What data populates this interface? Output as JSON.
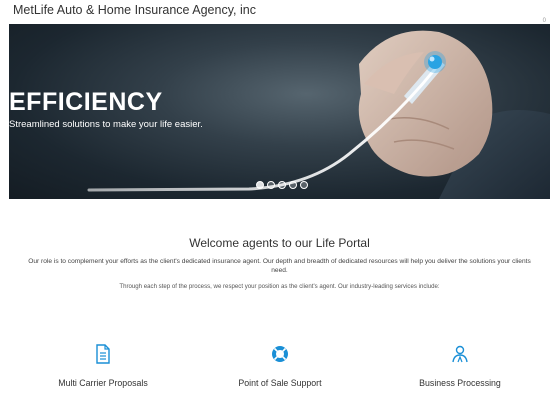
{
  "header": {
    "brand": "MetLife Auto & Home Insurance Agency, inc",
    "corner_mark": "0"
  },
  "hero": {
    "title": "EFFICIENCY",
    "subtitle": "Streamlined solutions to make your life easier.",
    "slide_count": 5,
    "active_slide": 1
  },
  "welcome": {
    "title": "Welcome agents to our Life Portal",
    "intro": "Our role is to complement your efforts as the client's dedicated insurance agent. Our depth and breadth of dedicated resources will help you deliver the solutions your clients need.",
    "intro2": "Through each step of the process, we respect your position as the client's agent. Our industry-leading services include:"
  },
  "services": [
    {
      "label": "Multi Carrier Proposals",
      "icon": "document-icon"
    },
    {
      "label": "Point of Sale Support",
      "icon": "lifebuoy-icon"
    },
    {
      "label": "Business Processing",
      "icon": "people-icon"
    }
  ],
  "colors": {
    "accent": "#1a8fd6",
    "hero_bg": "#1c2730",
    "text": "#333333"
  }
}
